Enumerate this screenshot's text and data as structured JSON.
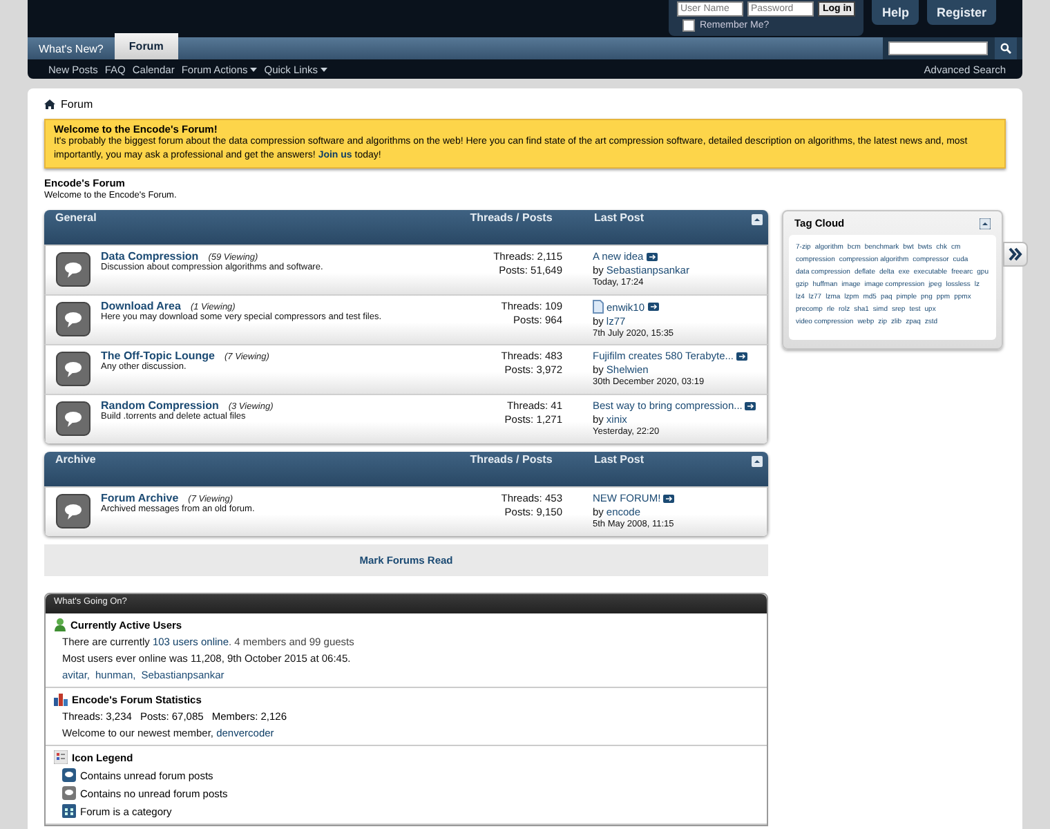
{
  "header": {
    "login": {
      "username_placeholder": "User Name",
      "password_placeholder": "Password",
      "button": "Log in",
      "remember": "Remember Me?",
      "remember_checked": false
    },
    "buttons": [
      "Help",
      "Register"
    ],
    "tabs": [
      {
        "label": "What's New?",
        "selected": false
      },
      {
        "label": "Forum",
        "selected": true
      }
    ],
    "subnav": [
      {
        "label": "New Posts",
        "dropdown": false
      },
      {
        "label": "FAQ",
        "dropdown": false
      },
      {
        "label": "Calendar",
        "dropdown": false
      },
      {
        "label": "Forum Actions",
        "dropdown": true
      },
      {
        "label": "Quick Links",
        "dropdown": true
      }
    ],
    "advanced_search": "Advanced Search"
  },
  "breadcrumb": "Forum",
  "notice": {
    "title": "Welcome to the Encode's Forum!",
    "text_before": "It's probably the biggest forum about the data compression software and algorithms on the web! Here you can find state of the art compression software, detailed description on algorithms, the latest news and, most importantly, you may ask a professional and get the answers!",
    "link": "Join us",
    "text_after": "today!"
  },
  "forum_title": "Encode's Forum",
  "forum_subtitle": "Welcome to the Encode's Forum.",
  "sections": [
    {
      "title": "General",
      "col_stats": "Threads / Posts",
      "col_last": "Last Post",
      "forums": [
        {
          "name": "Data Compression",
          "viewing": "(59 Viewing)",
          "description": "Discussion about compression algorithms and software.",
          "threads": "Threads: 2,115",
          "posts": "Posts: 51,649",
          "last_title": "A new idea",
          "doc_icon": false,
          "by": "by",
          "last_by": "Sebastianpsankar",
          "last_time": "Today, 17:24"
        },
        {
          "name": "Download Area",
          "viewing": "(1 Viewing)",
          "description": "Here you may download some very special compressors and test files.",
          "threads": "Threads: 109",
          "posts": "Posts: 964",
          "last_title": "enwik10",
          "doc_icon": true,
          "by": "by",
          "last_by": "lz77",
          "last_time": "7th July 2020, 15:35"
        },
        {
          "name": "The Off-Topic Lounge",
          "viewing": "(7 Viewing)",
          "description": "Any other discussion.",
          "threads": "Threads: 483",
          "posts": "Posts: 3,972",
          "last_title": "Fujifilm creates 580 Terabyte...",
          "doc_icon": false,
          "by": "by",
          "last_by": "Shelwien",
          "last_time": "30th December 2020, 03:19"
        },
        {
          "name": "Random Compression",
          "viewing": "(3 Viewing)",
          "description": "Build .torrents and delete actual files",
          "threads": "Threads: 41",
          "posts": "Posts: 1,271",
          "last_title": "Best way to bring compression...",
          "doc_icon": false,
          "by": "by",
          "last_by": "xinix",
          "last_time": "Yesterday, 22:20"
        }
      ]
    },
    {
      "title": "Archive",
      "col_stats": "Threads / Posts",
      "col_last": "Last Post",
      "forums": [
        {
          "name": "Forum Archive",
          "viewing": "(7 Viewing)",
          "description": "Archived messages from an old forum.",
          "threads": "Threads: 453",
          "posts": "Posts: 9,150",
          "last_title": "NEW FORUM!",
          "doc_icon": false,
          "by": "by",
          "last_by": "encode",
          "last_time": "5th May 2008, 11:15"
        }
      ]
    }
  ],
  "mark_read": "Mark Forums Read",
  "whats_going_on": {
    "title": "What's Going On?",
    "active": {
      "title": "Currently Active Users",
      "before": "There are currently",
      "link": "103 users online",
      "after": ". 4 members and 99 guests",
      "most": "Most users ever online was 11,208, 9th October 2015 at 06:45.",
      "users": [
        "avitar,",
        "hunman,",
        "Sebastianpsankar"
      ]
    },
    "stats": {
      "title": "Encode's Forum Statistics",
      "items": [
        "Threads: 3,234",
        "Posts: 67,085",
        "Members: 2,126"
      ],
      "newest_before": "Welcome to our newest member,",
      "newest": "denvercoder"
    },
    "legend": {
      "title": "Icon Legend",
      "items": [
        {
          "kind": "unread",
          "label": "Contains unread forum posts"
        },
        {
          "kind": "read",
          "label": "Contains no unread forum posts"
        },
        {
          "kind": "category",
          "label": "Forum is a category"
        }
      ]
    }
  },
  "tag_cloud": {
    "title": "Tag Cloud",
    "tags": [
      "7-zip",
      "algorithm",
      "bcm",
      "benchmark",
      "bwt",
      "bwts",
      "chk",
      "cm",
      "compression",
      "compression algorithm",
      "compressor",
      "cuda",
      "data compression",
      "deflate",
      "delta",
      "exe",
      "executable",
      "freearc",
      "gpu",
      "gzip",
      "huffman",
      "image",
      "image compression",
      "jpeg",
      "lossless",
      "lz",
      "lz4",
      "lz77",
      "lzma",
      "lzpm",
      "md5",
      "paq",
      "pimple",
      "png",
      "ppm",
      "ppmx",
      "precomp",
      "rle",
      "rolz",
      "sha1",
      "simd",
      "srep",
      "test",
      "upx",
      "video compression",
      "webp",
      "zip",
      "zlib",
      "zpaq",
      "zstd"
    ]
  }
}
